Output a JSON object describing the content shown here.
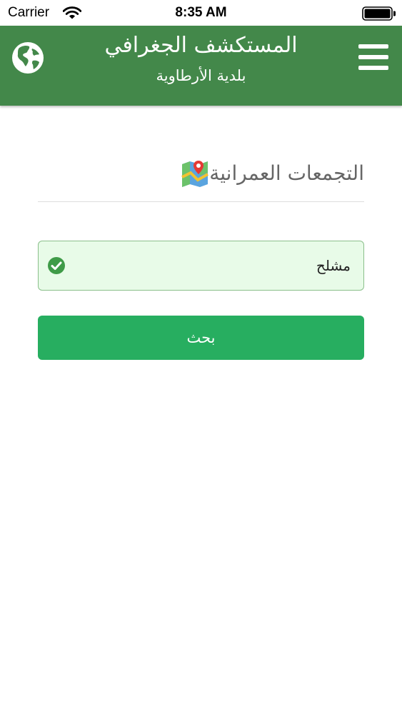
{
  "status_bar": {
    "carrier": "Carrier",
    "time": "8:35 AM",
    "wifi_icon": "wifi-icon",
    "battery_icon": "battery-icon"
  },
  "header": {
    "title": "المستكشف الجغرافي",
    "subtitle": "بلدية الأرطاوية",
    "background_color": "#43884a",
    "left_icon": "globe-icon",
    "right_icon": "hamburger-menu-icon"
  },
  "section": {
    "title": "التجمعات العمرانية",
    "icon": "map-icon"
  },
  "select": {
    "value": "مشلح",
    "status_icon": "check-circle-icon",
    "background_color": "#e8fbe8",
    "border_color": "#8bbf8b"
  },
  "search_button": {
    "label": "بحث",
    "color": "#27ae60"
  }
}
